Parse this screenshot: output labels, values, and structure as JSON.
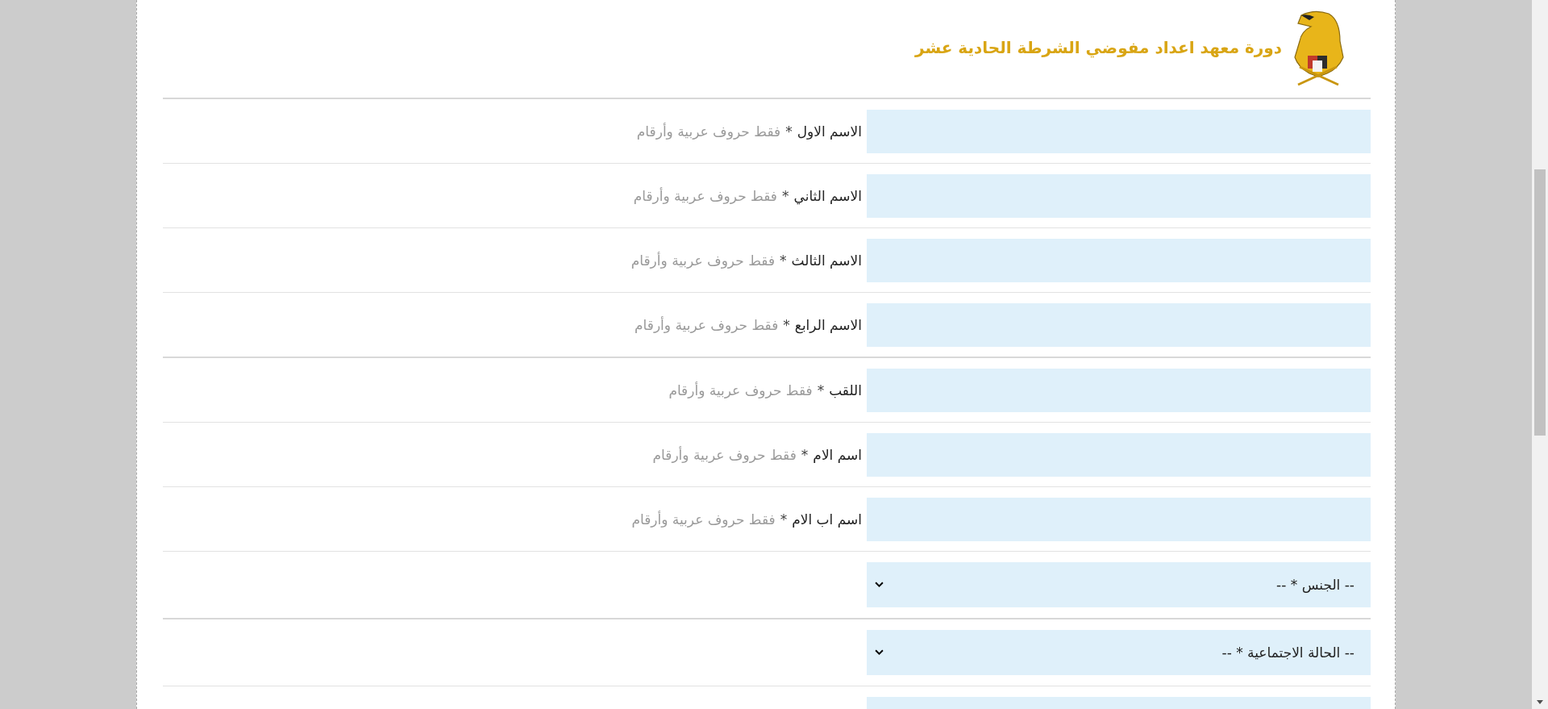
{
  "header": {
    "title": "دورة معهد اعداد مفوضي الشرطة الحادية عشر"
  },
  "fields": [
    {
      "kind": "text",
      "label": "الاسم الاول",
      "required": "*",
      "hint": "فقط حروف عربية وأرقام"
    },
    {
      "kind": "text",
      "label": "الاسم الثاني",
      "required": "*",
      "hint": "فقط حروف عربية وأرقام"
    },
    {
      "kind": "text",
      "label": "الاسم الثالث",
      "required": "*",
      "hint": "فقط حروف عربية وأرقام"
    },
    {
      "kind": "text",
      "label": "الاسم الرابع",
      "required": "*",
      "hint": "فقط حروف عربية وأرقام"
    },
    {
      "kind": "text",
      "label": "اللقب",
      "required": "*",
      "hint": "فقط حروف عربية وأرقام"
    },
    {
      "kind": "text",
      "label": "اسم الام",
      "required": "*",
      "hint": "فقط حروف عربية وأرقام"
    },
    {
      "kind": "text",
      "label": "اسم اب الام",
      "required": "*",
      "hint": "فقط حروف عربية وأرقام"
    },
    {
      "kind": "select",
      "value": "-- الجنس * --"
    },
    {
      "kind": "select",
      "value": "-- الحالة الاجتماعية * --"
    },
    {
      "kind": "select"
    }
  ]
}
